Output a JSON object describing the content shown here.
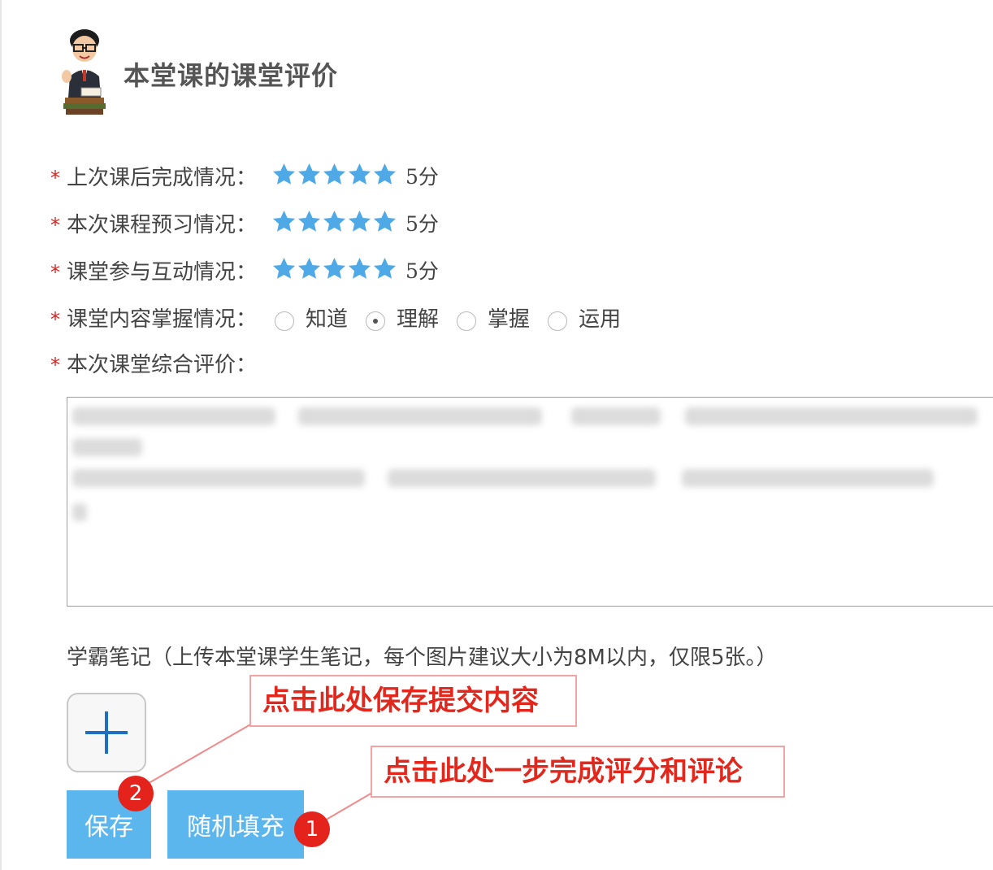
{
  "header": {
    "title": "本堂课的课堂评价"
  },
  "ratings": [
    {
      "label": "上次课后完成情况：",
      "stars": 5,
      "score": "5分"
    },
    {
      "label": "本次课程预习情况：",
      "stars": 5,
      "score": "5分"
    },
    {
      "label": "课堂参与互动情况：",
      "stars": 5,
      "score": "5分"
    }
  ],
  "mastery": {
    "label": "课堂内容掌握情况：",
    "options": [
      "知道",
      "理解",
      "掌握",
      "运用"
    ],
    "selected": "理解"
  },
  "comment": {
    "label": "本次课堂综合评价："
  },
  "notes": {
    "label": "学霸笔记（上传本堂课学生笔记，每个图片建议大小为8M以内，仅限5张。）"
  },
  "buttons": {
    "save": "保存",
    "random_fill": "随机填充"
  },
  "annotations": {
    "save_hint": "点击此处保存提交内容",
    "random_hint": "点击此处一步完成评分和评论",
    "badge_save": "2",
    "badge_random": "1"
  },
  "required_mark": "*",
  "colors": {
    "star": "#4fa9e6",
    "button": "#5cb6ee",
    "required": "#e0201c",
    "callout": "#e2271d"
  },
  "icons": {
    "star": "star-icon",
    "plus": "plus-icon",
    "avatar": "teacher-avatar"
  }
}
